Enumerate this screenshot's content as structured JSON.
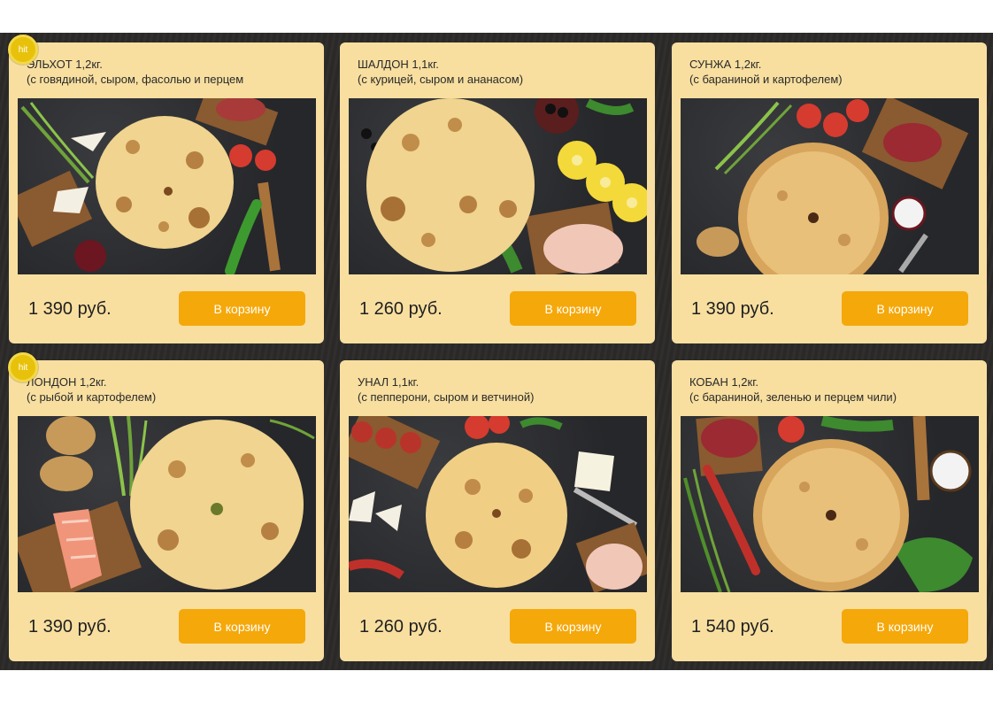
{
  "products": [
    {
      "name": "ЭЛЬХОТ 1,2кг.",
      "desc": "(с говядиной, сыром, фасолью и перцем",
      "price": "1 390 руб.",
      "button": "В корзину",
      "badge": "hit"
    },
    {
      "name": "ШАЛДОН 1,1кг.",
      "desc": "(с курицей, сыром и ананасом)",
      "price": "1 260 руб.",
      "button": "В корзину"
    },
    {
      "name": "СУНЖА 1,2кг.",
      "desc": "(с бараниной и картофелем)",
      "price": "1 390 руб.",
      "button": "В корзину"
    },
    {
      "name": "ЛОНДОН 1,2кг.",
      "desc": "(с рыбой и картофелем)",
      "price": "1 390 руб.",
      "button": "В корзину",
      "badge": "hit"
    },
    {
      "name": "УНАЛ 1,1кг.",
      "desc": "(с пепперони, сыром и ветчиной)",
      "price": "1 260 руб.",
      "button": "В корзину"
    },
    {
      "name": "КОБАН 1,2кг.",
      "desc": "(с бараниной, зеленью и перцем чили)",
      "price": "1 540 руб.",
      "button": "В корзину"
    }
  ],
  "colors": {
    "card_bg": "#f8dfa0",
    "button": "#f5a80a",
    "badge": "#e8c10a",
    "page_dark": "#2b2a29"
  }
}
